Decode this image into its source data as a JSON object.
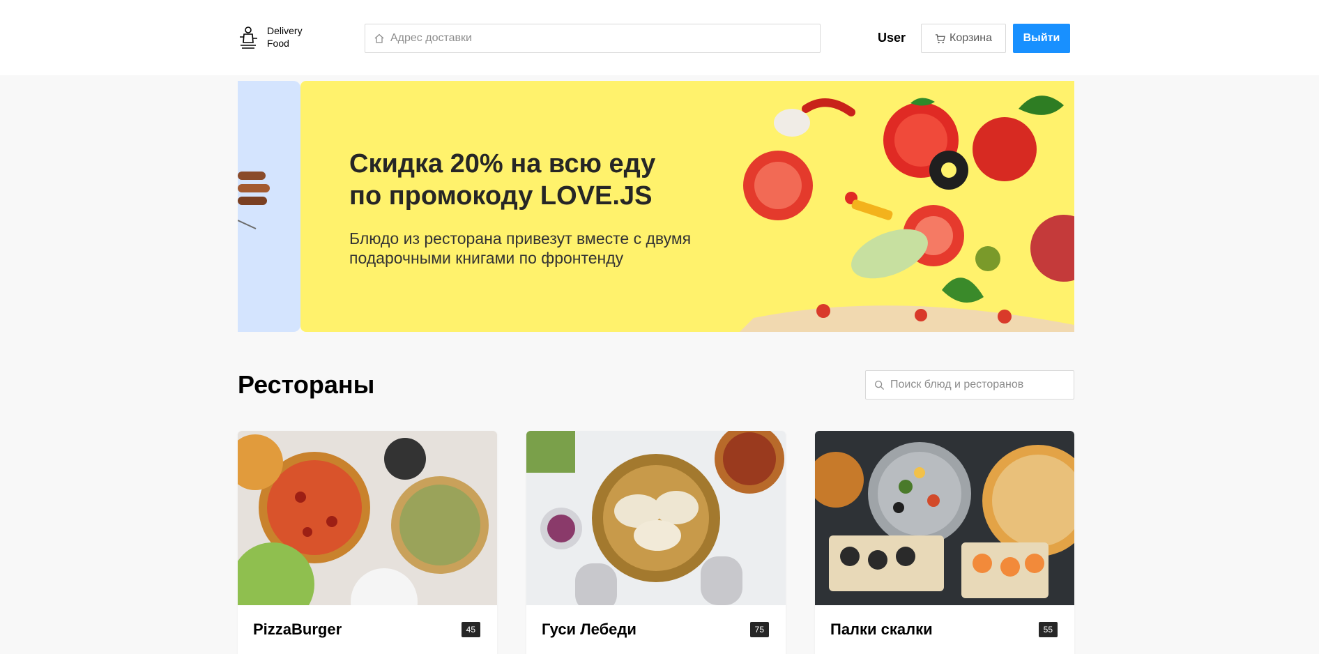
{
  "header": {
    "logo_line1": "Delivery",
    "logo_line2": "Food",
    "address_placeholder": "Адрес доставки",
    "user_name": "User",
    "cart_label": "Корзина",
    "logout_label": "Выйти"
  },
  "promo": {
    "title": "Скидка 20% на всю еду\nпо промокоду LOVE.JS",
    "text": "Блюдо из ресторана привезут вместе с двумя\nподарочными книгами по фронтенду",
    "background_color": "#fff26c"
  },
  "restaurants": {
    "title": "Рестораны",
    "search_placeholder": "Поиск блюд и ресторанов",
    "items": [
      {
        "name": "PizzaBurger",
        "time": "45"
      },
      {
        "name": "Гуси Лебеди",
        "time": "75"
      },
      {
        "name": "Палки скалки",
        "time": "55"
      }
    ]
  },
  "colors": {
    "accent": "#1890ff",
    "badge": "#262626"
  }
}
